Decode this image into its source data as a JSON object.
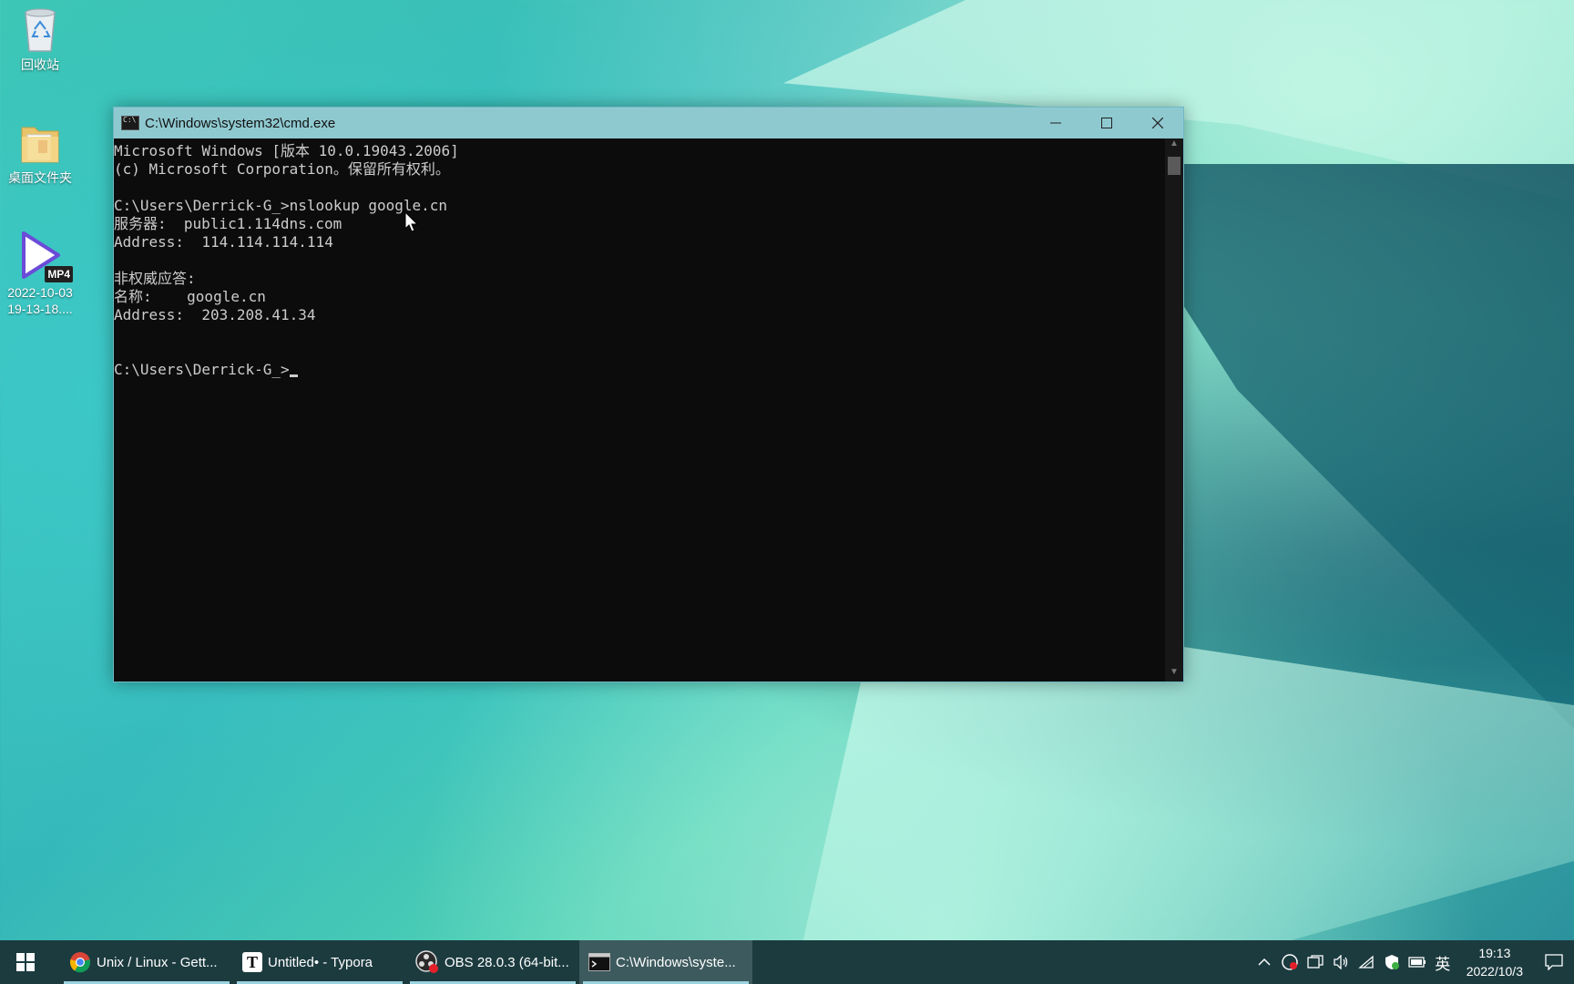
{
  "desktop": {
    "icons": [
      {
        "label": "回收站",
        "icon": "recycle-bin-icon"
      },
      {
        "label": "桌面文件夹",
        "icon": "folder-icon"
      },
      {
        "label_line1": "2022-10-03",
        "label_line2": "19-13-18....",
        "badge": "MP4",
        "icon": "video-file-icon"
      }
    ]
  },
  "cmd": {
    "title": "C:\\Windows\\system32\\cmd.exe",
    "lines": [
      "Microsoft Windows [版本 10.0.19043.2006]",
      "(c) Microsoft Corporation。保留所有权利。",
      "",
      "C:\\Users\\Derrick-G_>nslookup google.cn",
      "服务器:  public1.114dns.com",
      "Address:  114.114.114.114",
      "",
      "非权威应答:",
      "名称:    google.cn",
      "Address:  203.208.41.34",
      "",
      "",
      "C:\\Users\\Derrick-G_>"
    ],
    "buttons": {
      "minimize": "—",
      "maximize": "☐",
      "close": "✕"
    }
  },
  "taskbar": {
    "items": [
      {
        "label": "Unix / Linux - Gett...",
        "icon": "chrome-icon"
      },
      {
        "label": "Untitled• - Typora",
        "icon": "typora-icon",
        "icon_letter": "T"
      },
      {
        "label": "OBS 28.0.3 (64-bit...",
        "icon": "obs-icon"
      },
      {
        "label": "C:\\Windows\\syste...",
        "icon": "cmd-icon"
      }
    ],
    "tray": {
      "ime": "英",
      "time": "19:13",
      "date": "2022/10/3"
    }
  }
}
